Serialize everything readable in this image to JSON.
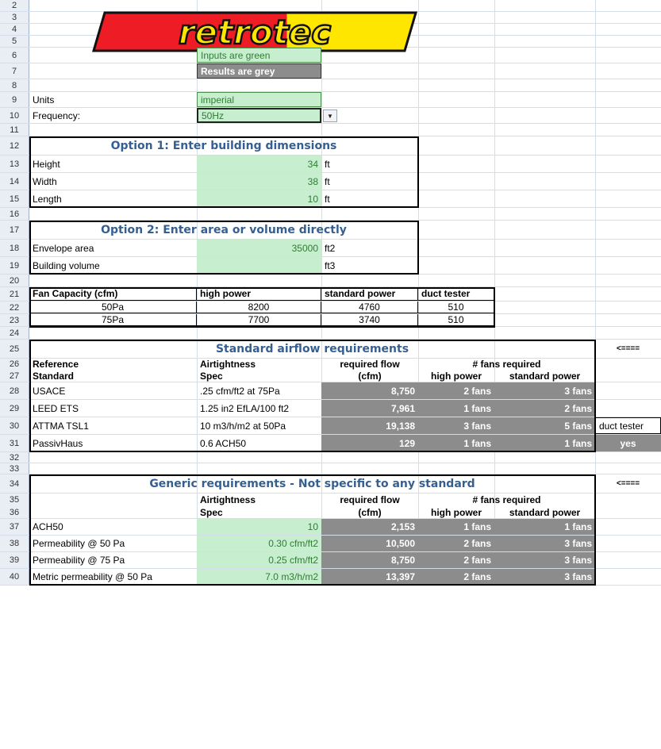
{
  "logo": {
    "text": "retrotec"
  },
  "legend": {
    "inputs": "Inputs are green",
    "results": "Results are grey"
  },
  "units": {
    "label": "Units",
    "value": "imperial"
  },
  "frequency": {
    "label": "Frequency:",
    "value": "50Hz"
  },
  "option1": {
    "title": "Option 1: Enter building dimensions",
    "height": {
      "label": "Height",
      "value": "34",
      "unit": "ft"
    },
    "width": {
      "label": "Width",
      "value": "38",
      "unit": "ft"
    },
    "length": {
      "label": "Length",
      "value": "10",
      "unit": "ft"
    }
  },
  "option2": {
    "title": "Option 2: Enter area or volume directly",
    "area": {
      "label": "Envelope area",
      "value": "35000",
      "unit": "ft2"
    },
    "volume": {
      "label": "Building volume",
      "value": "",
      "unit": "ft3"
    }
  },
  "fan_capacity": {
    "headers": [
      "Fan Capacity (cfm)",
      "high power",
      "standard power",
      "duct tester"
    ],
    "rows": [
      [
        "50Pa",
        "8200",
        "4760",
        "510"
      ],
      [
        "75Pa",
        "7700",
        "3740",
        "510"
      ]
    ]
  },
  "standard": {
    "title": "Standard airflow requirements",
    "arrow": "<====",
    "h1": [
      "Reference",
      "Airtightness",
      "required flow",
      "# fans required"
    ],
    "h2": [
      "Standard",
      "Spec",
      "(cfm)",
      "high power",
      "standard power"
    ],
    "rows": [
      [
        "USACE",
        ".25 cfm/ft2 at 75Pa",
        "8,750",
        "2 fans",
        "3 fans",
        ""
      ],
      [
        "LEED ETS",
        "1.25 in2 EfLA/100 ft2",
        "7,961",
        "1 fans",
        "2 fans",
        ""
      ],
      [
        "ATTMA TSL1",
        "10 m3/h/m2 at 50Pa",
        "19,138",
        "3 fans",
        "5 fans",
        "duct tester"
      ],
      [
        "PassivHaus",
        "0.6 ACH50",
        "129",
        "1 fans",
        "1 fans",
        "yes"
      ]
    ]
  },
  "generic": {
    "title": "Generic requirements - Not specific to any standard",
    "arrow": "<====",
    "h1": [
      "",
      "Airtightness",
      "required flow",
      "# fans required"
    ],
    "h2": [
      "",
      "Spec",
      "(cfm)",
      "high power",
      "standard power"
    ],
    "rows": [
      [
        "ACH50",
        "10",
        "2,153",
        "1 fans",
        "1 fans"
      ],
      [
        "Permeability @ 50 Pa",
        "0.30 cfm/ft2",
        "10,500",
        "2 fans",
        "3 fans"
      ],
      [
        "Permeability @ 75 Pa",
        "0.25 cfm/ft2",
        "8,750",
        "2 fans",
        "3 fans"
      ],
      [
        "Metric permeability @ 50 Pa",
        "7.0 m3/h/m2",
        "13,397",
        "2 fans",
        "3 fans"
      ]
    ]
  },
  "row_numbers": [
    "2",
    "3",
    "4",
    "5",
    "6",
    "7",
    "8",
    "9",
    "10",
    "11",
    "12",
    "13",
    "14",
    "15",
    "16",
    "17",
    "18",
    "19",
    "20",
    "21",
    "22",
    "23",
    "24",
    "25",
    "26",
    "27",
    "28",
    "29",
    "30",
    "31",
    "32",
    "33",
    "34",
    "35",
    "36",
    "37",
    "38",
    "39",
    "40"
  ]
}
